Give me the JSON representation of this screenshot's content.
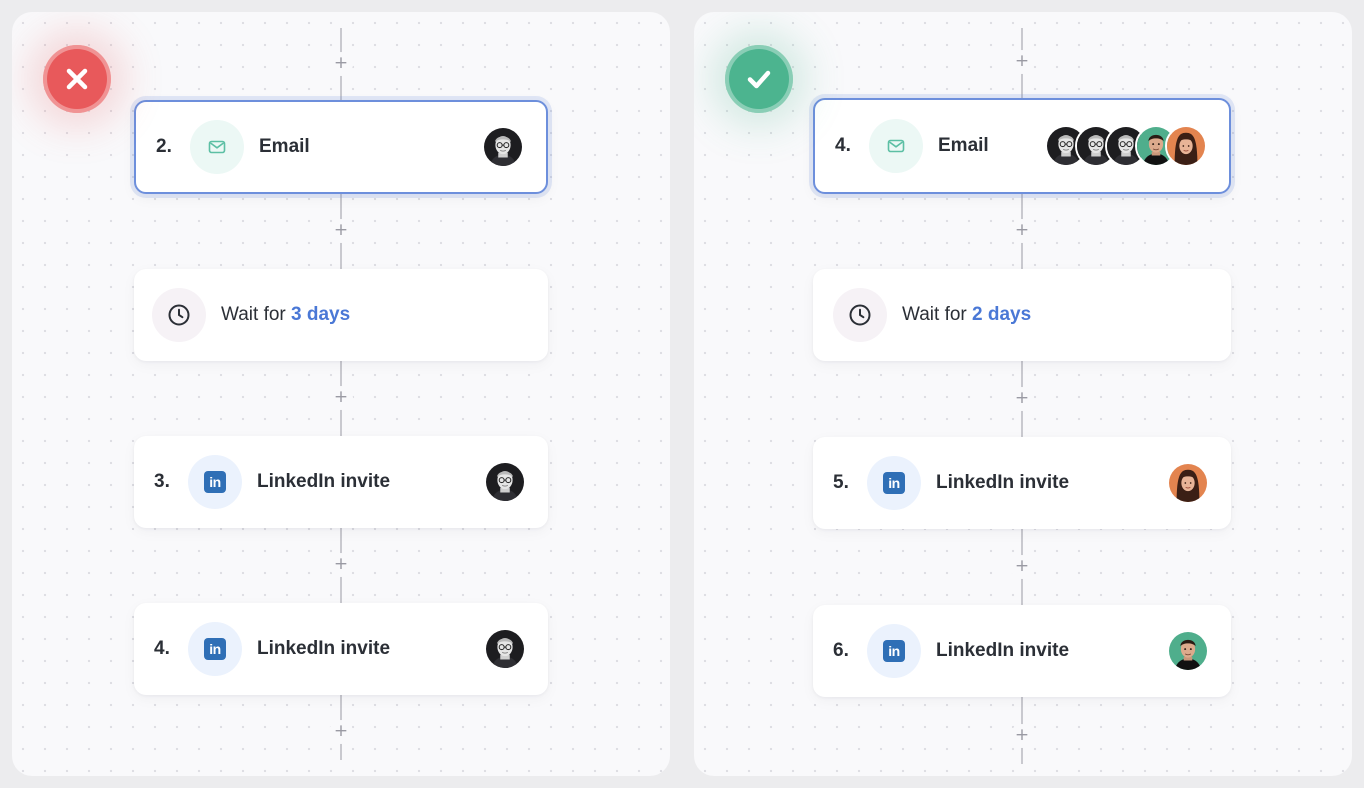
{
  "left_panel": {
    "status_icon": "x-icon",
    "steps": [
      {
        "number": "2.",
        "label": "Email",
        "icon": "mail-icon",
        "avatars": [
          "mono-man"
        ]
      },
      {
        "type": "wait",
        "prefix": "Wait for",
        "duration": "3 days",
        "icon": "clock-icon"
      },
      {
        "number": "3.",
        "label": "LinkedIn invite",
        "icon": "linkedin-icon",
        "avatars": [
          "mono-man"
        ]
      },
      {
        "number": "4.",
        "label": "LinkedIn invite",
        "icon": "linkedin-icon",
        "avatars": [
          "mono-man"
        ]
      }
    ]
  },
  "right_panel": {
    "status_icon": "check-icon",
    "steps": [
      {
        "number": "4.",
        "label": "Email",
        "icon": "mail-icon",
        "avatars": [
          "mono-man",
          "mono-man",
          "mono-man",
          "green-man",
          "orange-woman"
        ]
      },
      {
        "type": "wait",
        "prefix": "Wait for",
        "duration": "2 days",
        "icon": "clock-icon"
      },
      {
        "number": "5.",
        "label": "LinkedIn invite",
        "icon": "linkedin-icon",
        "avatars": [
          "orange-woman"
        ]
      },
      {
        "number": "6.",
        "label": "LinkedIn invite",
        "icon": "linkedin-icon",
        "avatars": [
          "green-man"
        ]
      }
    ]
  },
  "plus_symbol": "+",
  "linkedin_glyph": "in",
  "colors": {
    "accent_blue": "#4a78d6",
    "selected_border": "#6d8fdc",
    "error_red": "#e8595b",
    "success_green": "#4cb48f",
    "email_icon": "#5cbfa4",
    "linkedin_blue": "#2f6fb6"
  }
}
